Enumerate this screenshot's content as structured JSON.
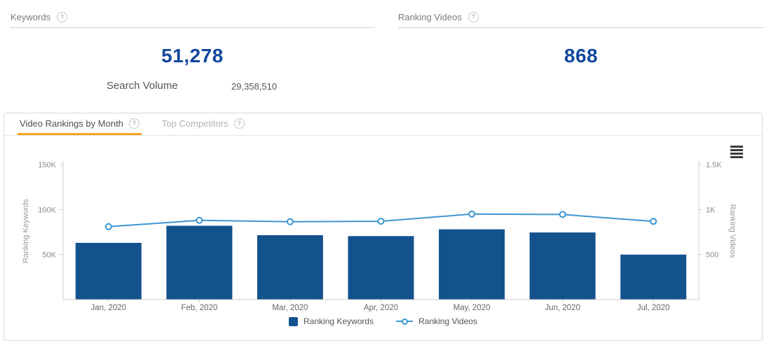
{
  "icons": {
    "help": "?"
  },
  "colors": {
    "kpi_value_blue": "#11489e",
    "bar_blue": "#14528e",
    "line_blue": "#3c96d3",
    "tab_accent_orange": "#f5a623"
  },
  "kpi_cards": {
    "keywords": {
      "label": "Keywords",
      "value": "51,278",
      "sub_label": "Search Volume",
      "sub_value": "29,358,510"
    },
    "ranking_videos": {
      "label": "Ranking Videos",
      "value": "868"
    }
  },
  "panel": {
    "tabs": [
      {
        "label": "Video Rankings by Month",
        "active": true
      },
      {
        "label": "Top Competitors",
        "active": false
      }
    ],
    "menu_icon": "hamburger-menu-icon"
  },
  "chart_data": {
    "type": "bar+line combo, dual axis",
    "categories": [
      "Jan, 2020",
      "Feb, 2020",
      "Mar, 2020",
      "Apr, 2020",
      "May, 2020",
      "Jun, 2020",
      "Jul, 2020"
    ],
    "series": [
      {
        "name": "Ranking Keywords",
        "type": "bar",
        "axis": "left",
        "color": "#14528e",
        "values": [
          63000,
          82000,
          71500,
          70500,
          78000,
          74500,
          50000
        ]
      },
      {
        "name": "Ranking Videos",
        "type": "line",
        "axis": "right",
        "color": "#3c96d3",
        "values": [
          810,
          880,
          865,
          870,
          950,
          945,
          868
        ]
      }
    ],
    "left_axis": {
      "title": "Ranking Keywords",
      "min": 0,
      "max": 150000,
      "ticks": [
        {
          "value": 150000,
          "label": "150K"
        },
        {
          "value": 100000,
          "label": "100K"
        },
        {
          "value": 50000,
          "label": "50K"
        }
      ]
    },
    "right_axis": {
      "title": "Ranking Videos",
      "min": 0,
      "max": 1500,
      "ticks": [
        {
          "value": 1500,
          "label": "1.5K"
        },
        {
          "value": 1000,
          "label": "1K"
        },
        {
          "value": 500,
          "label": "500"
        }
      ]
    },
    "grid": false,
    "legend_position": "bottom-center"
  }
}
